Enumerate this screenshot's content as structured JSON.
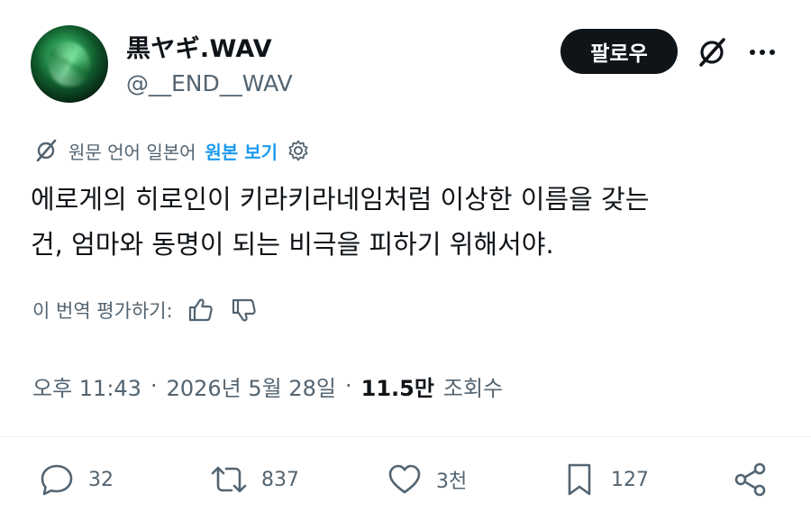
{
  "author": {
    "display_name": "黒ヤギ.WAV",
    "handle": "@__END__WAV"
  },
  "header": {
    "follow_label": "팔로우",
    "icons": [
      "grok-icon",
      "more-icon"
    ]
  },
  "translation": {
    "info": "원문 언어 일본어",
    "show_original": "원본 보기",
    "rate_label": "이 번역 평가하기:"
  },
  "tweet": {
    "lines": [
      "에로게의 히로인이 키라키라네임처럼 이상한 이름을 갖는",
      "건, 엄마와 동명이 되는 비극을 피하기 위해서야."
    ]
  },
  "meta": {
    "time": "오후 11:43",
    "date": "2026년 5월 28일",
    "views": "11.5만",
    "views_label": "조회수"
  },
  "actions": {
    "replies": "32",
    "reposts": "837",
    "likes": "3천",
    "bookmarks": "127"
  },
  "colors": {
    "text": "#0f1419",
    "secondary": "#536471",
    "link": "#1d9bf0",
    "button_bg": "#0f1419"
  }
}
